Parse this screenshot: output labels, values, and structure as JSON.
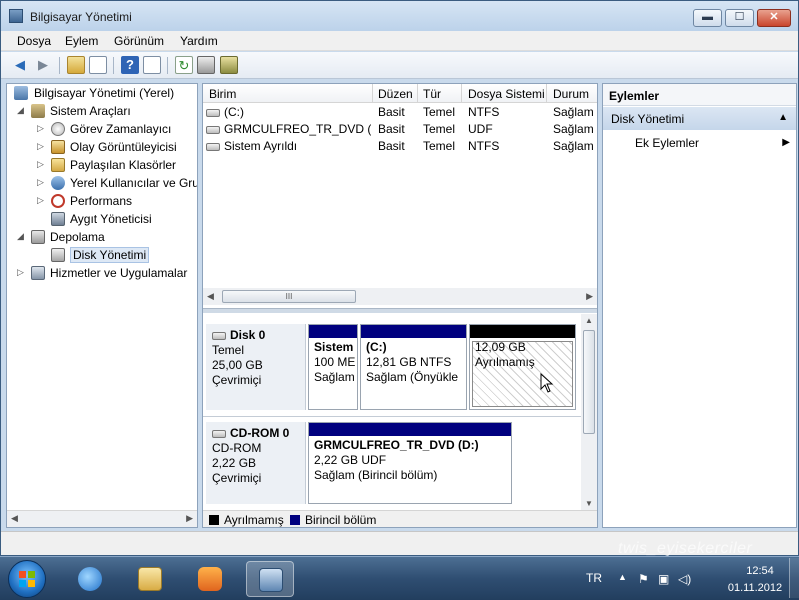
{
  "window": {
    "title": "Bilgisayar Yönetimi",
    "min": "▬",
    "max": "☐",
    "close": "✕"
  },
  "menu": [
    "Dosya",
    "Eylem",
    "Görünüm",
    "Yardım"
  ],
  "toolbar": {
    "back": "back-icon",
    "forward": "forward-icon"
  },
  "tree": {
    "items": [
      {
        "label": "Bilgisayar Yönetimi (Yerel)",
        "icon": "computer-icon",
        "arrow": ""
      },
      {
        "label": "Sistem Araçları",
        "icon": "tools-icon",
        "arrow": "◢"
      },
      {
        "label": "Görev Zamanlayıcı",
        "icon": "clock-icon",
        "arrow": "▷"
      },
      {
        "label": "Olay Görüntüleyicisi",
        "icon": "event-viewer-icon",
        "arrow": "▷"
      },
      {
        "label": "Paylaşılan Klasörler",
        "icon": "shared-folder-icon",
        "arrow": "▷"
      },
      {
        "label": "Yerel Kullanıcılar ve Gru",
        "icon": "users-icon",
        "arrow": "▷"
      },
      {
        "label": "Performans",
        "icon": "performance-icon",
        "arrow": "▷"
      },
      {
        "label": "Aygıt Yöneticisi",
        "icon": "device-manager-icon",
        "arrow": ""
      },
      {
        "label": "Depolama",
        "icon": "storage-icon",
        "arrow": "◢"
      },
      {
        "label": "Disk Yönetimi",
        "icon": "disk-management-icon",
        "arrow": ""
      },
      {
        "label": "Hizmetler ve Uygulamalar",
        "icon": "services-icon",
        "arrow": "▷"
      }
    ]
  },
  "volumes": {
    "columns": [
      "Birim",
      "Düzen",
      "Tür",
      "Dosya Sistemi",
      "Durum"
    ],
    "rows": [
      [
        "(C:)",
        "Basit",
        "Temel",
        "NTFS",
        "Sağlam ("
      ],
      [
        "GRMCULFREO_TR_DVD (D:)",
        "Basit",
        "Temel",
        "UDF",
        "Sağlam ("
      ],
      [
        "Sistem Ayrıldı",
        "Basit",
        "Temel",
        "NTFS",
        "Sağlam ("
      ]
    ],
    "scroll_grip": "III"
  },
  "disks": [
    {
      "name": "Disk 0",
      "type": "Temel",
      "size": "25,00 GB",
      "status": "Çevrimiçi",
      "partitions": [
        {
          "name": "Sistem",
          "size": "100 ME",
          "status": "Sağlam"
        },
        {
          "name": "(C:)",
          "size": "12,81 GB NTFS",
          "status": "Sağlam (Önyükle"
        },
        {
          "name": "",
          "size": "12,09 GB",
          "status": "Ayrılmamış"
        }
      ]
    },
    {
      "name": "CD-ROM 0",
      "type": "CD-ROM",
      "size": "2,22 GB",
      "status": "Çevrimiçi",
      "partitions": [
        {
          "name": "GRMCULFREO_TR_DVD  (D:)",
          "size": "2,22 GB UDF",
          "status": "Sağlam (Birincil bölüm)"
        }
      ]
    }
  ],
  "legend": [
    {
      "label": "Ayrılmamış",
      "color": "#000000"
    },
    {
      "label": "Birincil bölüm",
      "color": "#00007f"
    }
  ],
  "colors": {
    "primary_partition": "#00007f",
    "unallocated": "#000000"
  },
  "actions": {
    "header": "Eylemler",
    "section": "Disk Yönetimi",
    "more": "Ek Eylemler"
  },
  "watermark": "twis_eyisekerciler",
  "taskbar": {
    "lang": "TR",
    "time": "12:54",
    "date": "01.11.2012"
  }
}
